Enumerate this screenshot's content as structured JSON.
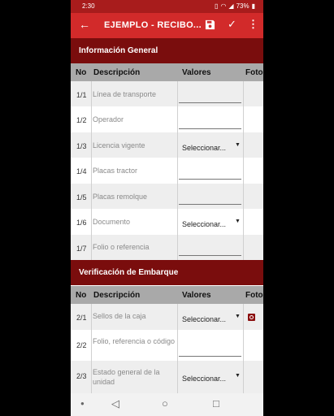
{
  "status": {
    "time": "2:30",
    "battery": "73%"
  },
  "appbar": {
    "title": "EJEMPLO - RECIBO..."
  },
  "columns": {
    "no": "No",
    "desc": "Descripción",
    "values": "Valores",
    "photo": "Foto"
  },
  "section1": {
    "title": "Información General",
    "rows": [
      {
        "no": "1/1",
        "desc": "Línea de transporte",
        "type": "input"
      },
      {
        "no": "1/2",
        "desc": "Operador",
        "type": "input"
      },
      {
        "no": "1/3",
        "desc": "Licencia vigente",
        "type": "select",
        "value": "Seleccionar..."
      },
      {
        "no": "1/4",
        "desc": "Placas tractor",
        "type": "input"
      },
      {
        "no": "1/5",
        "desc": "Placas remolque",
        "type": "input"
      },
      {
        "no": "1/6",
        "desc": "Documento",
        "type": "select",
        "value": "Seleccionar..."
      },
      {
        "no": "1/7",
        "desc": "Folio o referencia",
        "type": "input"
      }
    ]
  },
  "section2": {
    "title": "Verificación  de Embarque",
    "rows": [
      {
        "no": "2/1",
        "desc": "Sellos de la caja",
        "type": "select",
        "value": "Seleccionar...",
        "photo": true
      },
      {
        "no": "2/2",
        "desc": "Folio, referencia o código",
        "type": "input"
      },
      {
        "no": "2/3",
        "desc": "Estado general de la unidad",
        "type": "select",
        "value": "Seleccionar..."
      }
    ]
  },
  "icons": {
    "back": "arrow-left-icon",
    "save": "save-icon",
    "check": "check-icon",
    "more": "more-vert-icon",
    "camera": "camera-icon"
  },
  "colors": {
    "appbar": "#d22a2a",
    "section": "#7a0d0d",
    "header": "#a9a9a9"
  }
}
